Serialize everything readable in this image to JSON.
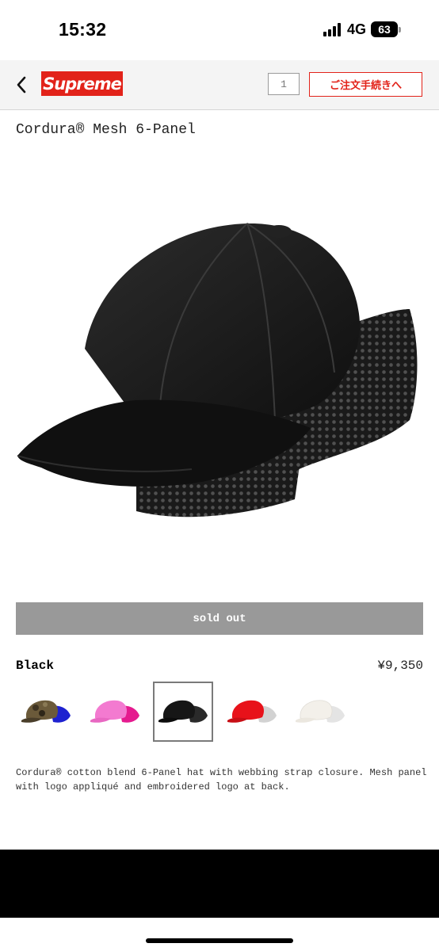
{
  "status_bar": {
    "time": "15:32",
    "network": "4G",
    "battery": "63"
  },
  "header": {
    "logo": "Supreme",
    "cart_count": "1",
    "checkout_label": "ご注文手続きへ"
  },
  "product": {
    "title": "Cordura® Mesh 6-Panel",
    "image_icon": "black-cap-image",
    "button_label": "sold out",
    "color": "Black",
    "price": "¥9,350",
    "swatches": [
      {
        "color": "Camo",
        "hex": "#6b5a3a",
        "accent": "#1e22d0"
      },
      {
        "color": "Pink",
        "hex": "#f37ad0",
        "accent": "#e51a8f"
      },
      {
        "color": "Black",
        "hex": "#161616",
        "accent": "#2a2a2a",
        "selected": true
      },
      {
        "color": "Red",
        "hex": "#e8121a",
        "accent": "#d2d2d2"
      },
      {
        "color": "White",
        "hex": "#f3f0ea",
        "accent": "#e4e4e4"
      }
    ],
    "description": "Cordura® cotton blend 6-Panel hat with webbing strap closure. Mesh panel with logo appliqué and embroidered logo at back."
  },
  "colors": {
    "brand_red": "#e2231a",
    "soldout_gray": "#999999",
    "header_bg": "#f4f4f4"
  }
}
